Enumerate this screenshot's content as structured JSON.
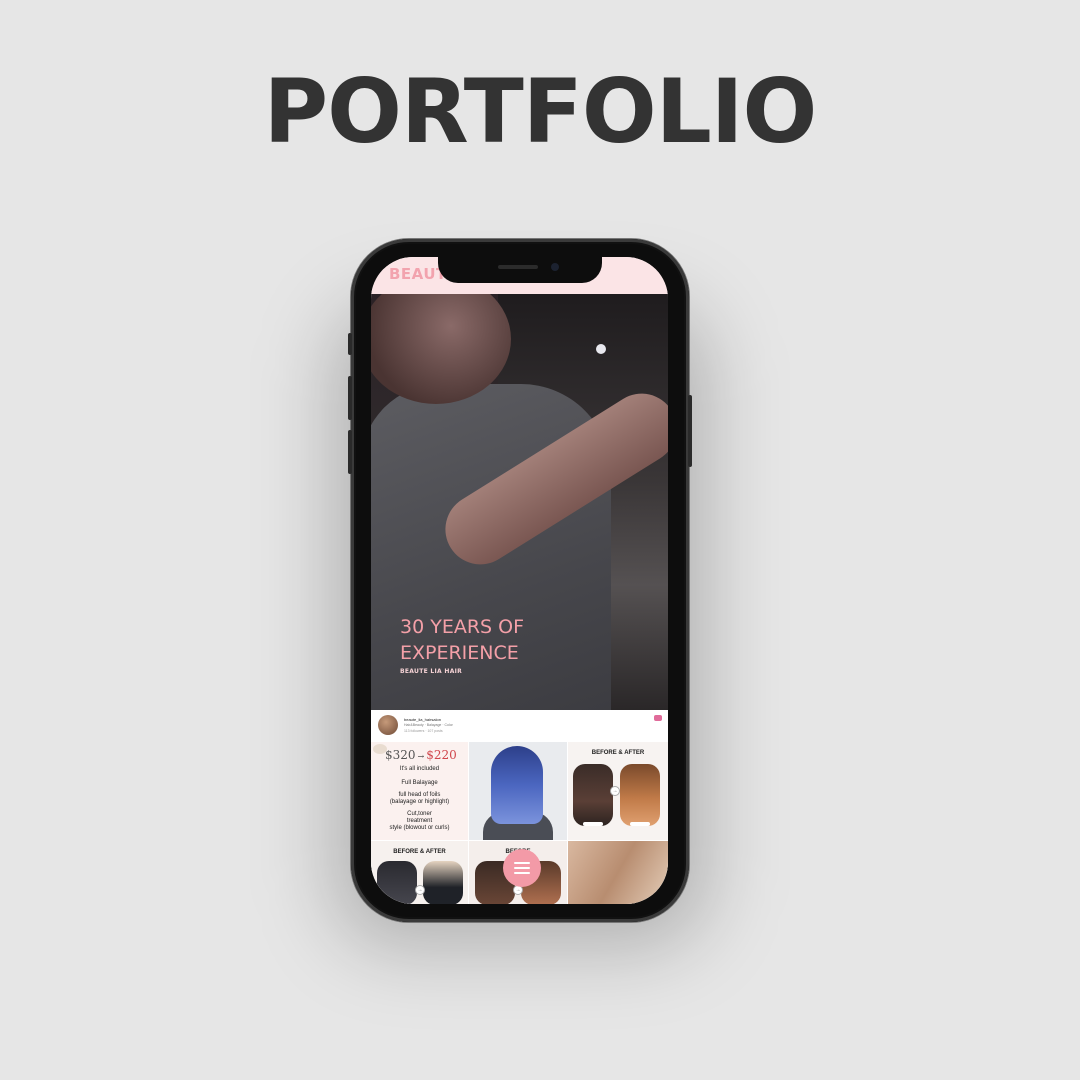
{
  "page": {
    "title": "PORTFOLIO"
  },
  "site": {
    "brand": "BEAUTE"
  },
  "hero": {
    "headline": "30 YEARS OF EXPERIENCE",
    "subtitle": "BEAUTE LIA HAIR"
  },
  "instagram": {
    "handle": "beaute_lia_hairsalon",
    "bio": "Hair&Beauty · Balayage · Color",
    "stats": "113 followers · 107 posts"
  },
  "grid": {
    "promo": {
      "old_price": "$320",
      "new_price": "$220",
      "lines": [
        "It's all included",
        "Full Balayage",
        "full head of foils",
        "(balayage or highlight)",
        "Cut,toner",
        "treatment",
        "style (blowout or curls)"
      ]
    },
    "before_after_label": "BEFORE & AFTER",
    "before_after_label_partial": "BEFORE"
  },
  "menu": {
    "icon": "hamburger-menu-icon"
  },
  "colors": {
    "accent_pink": "#f39aa7",
    "header_pink": "#fbe4e6",
    "headline_pink": "#f4a0a8",
    "price_red": "#d0474d",
    "page_background": "#e6e6e6",
    "title_dark": "#333333"
  }
}
